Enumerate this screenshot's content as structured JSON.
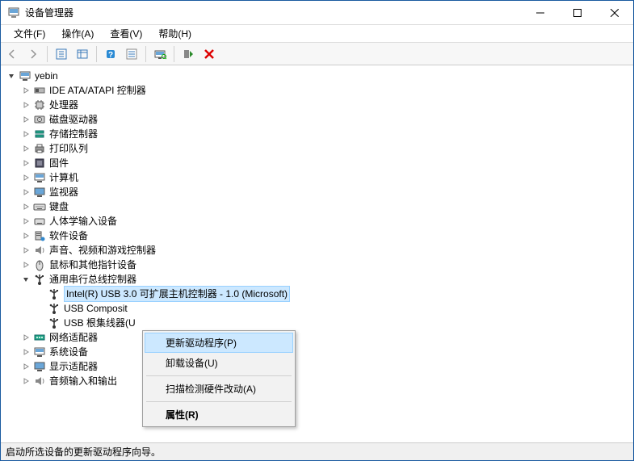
{
  "window": {
    "title": "设备管理器"
  },
  "menu": {
    "file": "文件(F)",
    "action": "操作(A)",
    "view": "查看(V)",
    "help": "帮助(H)"
  },
  "tree": {
    "root": "yebin",
    "categories": [
      "IDE ATA/ATAPI 控制器",
      "处理器",
      "磁盘驱动器",
      "存储控制器",
      "打印队列",
      "固件",
      "计算机",
      "监视器",
      "键盘",
      "人体学输入设备",
      "软件设备",
      "声音、视频和游戏控制器",
      "鼠标和其他指针设备",
      "通用串行总线控制器",
      "网络适配器",
      "系统设备",
      "显示适配器",
      "音频输入和输出"
    ],
    "usb": {
      "item0": "Intel(R) USB 3.0 可扩展主机控制器 - 1.0 (Microsoft)",
      "item1": "USB Composit",
      "item2": "USB 根集线器(U"
    }
  },
  "context_menu": {
    "update": "更新驱动程序(P)",
    "uninstall": "卸载设备(U)",
    "scan": "扫描检测硬件改动(A)",
    "properties": "属性(R)"
  },
  "statusbar": {
    "text": "启动所选设备的更新驱动程序向导。"
  }
}
